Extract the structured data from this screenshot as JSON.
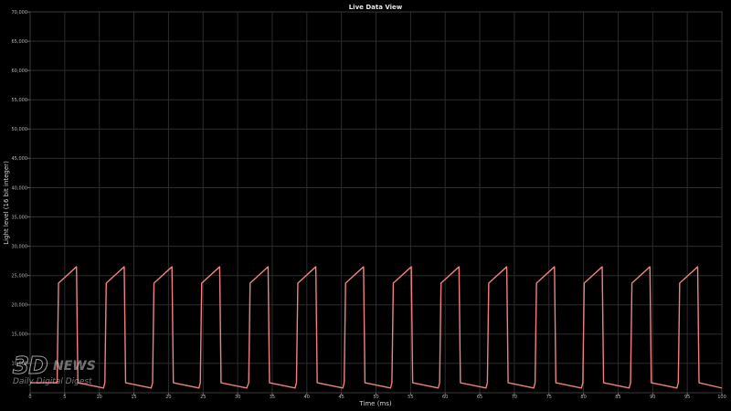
{
  "chart_data": {
    "type": "line",
    "title": "Live Data View",
    "xlabel": "Time (ms)",
    "ylabel": "Light level (16 bit integer)",
    "xlim": [
      0,
      100
    ],
    "ylim": [
      5000,
      70000
    ],
    "x_ticks": [
      0,
      5,
      10,
      15,
      20,
      25,
      30,
      35,
      40,
      45,
      50,
      55,
      60,
      65,
      70,
      75,
      80,
      85,
      90,
      95,
      100
    ],
    "x_tick_labels": [
      "0",
      "5",
      "10",
      "15",
      "20",
      "25",
      "30",
      "35",
      "40",
      "45",
      "50",
      "55",
      "60",
      "65",
      "70",
      "75",
      "80",
      "85",
      "90",
      "95",
      "100"
    ],
    "y_ticks": [
      10000,
      15000,
      20000,
      25000,
      30000,
      35000,
      40000,
      45000,
      50000,
      55000,
      60000,
      65000,
      70000
    ],
    "y_tick_labels": [
      "10,000",
      "15,000",
      "20,000",
      "25,000",
      "30,000",
      "35,000",
      "40,000",
      "45,000",
      "50,000",
      "55,000",
      "60,000",
      "65,000",
      "70,000"
    ],
    "grid": true,
    "line_color": "#f08080",
    "background": "#000000",
    "grid_color": "#2c2c2c",
    "pulse": {
      "rises_at": [
        3.9,
        10.8,
        17.7,
        24.6,
        31.6,
        38.5,
        45.4,
        52.3,
        59.2,
        66.1,
        73.0,
        79.9,
        86.8,
        93.7
      ],
      "low_level": 6700,
      "trough_level": 5800,
      "rise_level": 23700,
      "peak_level": 26500,
      "high_duration_ms": 2.8
    },
    "series": [
      {
        "x": [
          0,
          3.9,
          4.1,
          6.7,
          6.9,
          10.6,
          10.8,
          11.0,
          13.6,
          13.8,
          17.5,
          17.7,
          17.9,
          20.5,
          20.7,
          24.4,
          24.6,
          24.8,
          27.4,
          27.6,
          31.3,
          31.6,
          31.8,
          34.4,
          34.6,
          38.3,
          38.5,
          38.7,
          41.3,
          41.5,
          45.2,
          45.4,
          45.6,
          48.2,
          48.4,
          52.1,
          52.3,
          52.5,
          55.1,
          55.3,
          59.0,
          59.2,
          59.4,
          62.0,
          62.2,
          65.9,
          66.1,
          66.3,
          68.9,
          69.1,
          72.8,
          73.0,
          73.2,
          75.8,
          76.0,
          79.7,
          79.9,
          80.1,
          82.7,
          82.9,
          86.6,
          86.8,
          87.0,
          89.6,
          89.8,
          93.5,
          93.7,
          93.9,
          96.5,
          96.7,
          100
        ],
        "y": [
          6700,
          6700,
          23700,
          26500,
          6700,
          5800,
          6700,
          23700,
          26500,
          6700,
          5800,
          6700,
          23700,
          26500,
          6700,
          5800,
          6700,
          23700,
          26500,
          6700,
          5800,
          6700,
          23700,
          26500,
          6700,
          5800,
          6700,
          23700,
          26500,
          6700,
          5800,
          6700,
          23700,
          26500,
          6700,
          5800,
          6700,
          23700,
          26500,
          6700,
          5800,
          6700,
          23700,
          26500,
          6700,
          5800,
          6700,
          23700,
          26500,
          6700,
          5800,
          6700,
          23700,
          26500,
          6700,
          5800,
          6700,
          23700,
          26500,
          6700,
          5800,
          6700,
          23700,
          26500,
          6700,
          5800,
          6700,
          23700,
          26500,
          6700,
          5800
        ]
      }
    ]
  },
  "watermark": {
    "logo": "3D",
    "logo_suffix": "NEWS",
    "tagline": "Daily Digital Digest"
  }
}
